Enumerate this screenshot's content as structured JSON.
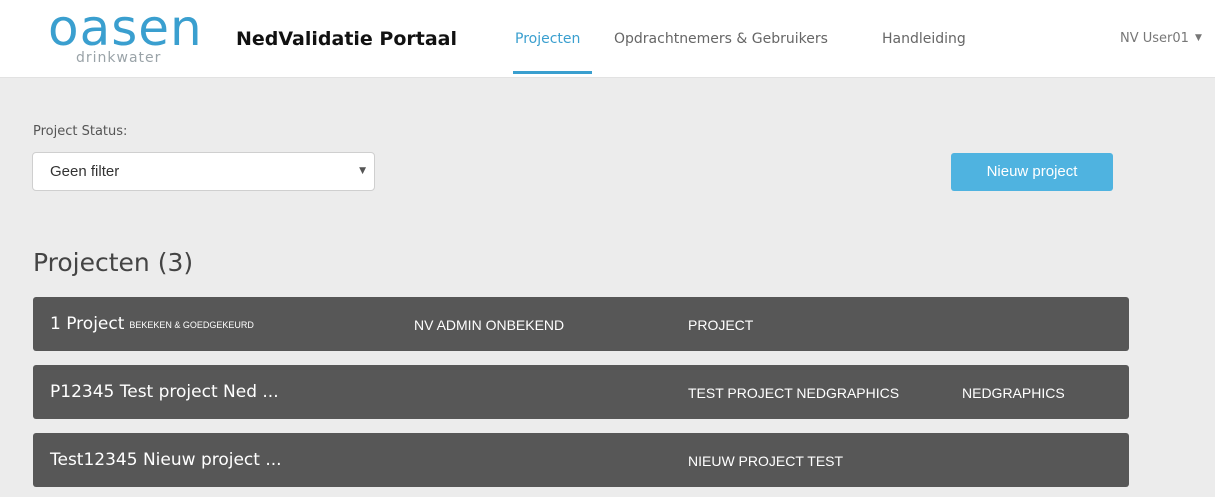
{
  "brand": {
    "logo_text": "oasen",
    "logo_sub": "drinkwater",
    "app_title": "NedValidatie Portaal",
    "accent_color": "#3a9fcf"
  },
  "nav": {
    "items": [
      {
        "label": "Projecten",
        "active": true
      },
      {
        "label": "Opdrachtnemers & Gebruikers",
        "active": false
      },
      {
        "label": "Handleiding",
        "active": false
      }
    ],
    "user": "NV User01"
  },
  "filter": {
    "label": "Project Status:",
    "selected": "Geen filter"
  },
  "actions": {
    "new_project": "Nieuw project"
  },
  "projects": {
    "heading": "Projecten (3)",
    "rows": [
      {
        "name": "1 Project",
        "badge": "BEKEKEN & GOEDGEKEURD",
        "col2": "NV ADMIN ONBEKEND",
        "col3": "PROJECT",
        "col4": ""
      },
      {
        "name": "P12345 Test project Ned ...",
        "badge": "",
        "col2": "",
        "col3": "TEST PROJECT NEDGRAPHICS",
        "col4": "NEDGRAPHICS"
      },
      {
        "name": "Test12345 Nieuw project ...",
        "badge": "",
        "col2": "",
        "col3": "NIEUW PROJECT TEST",
        "col4": ""
      }
    ]
  }
}
